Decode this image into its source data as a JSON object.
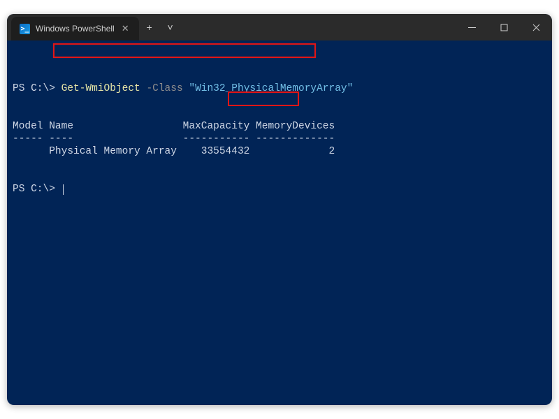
{
  "titlebar": {
    "tab_title": "Windows PowerShell",
    "newtab": "+",
    "dropdown": "˅"
  },
  "terminal": {
    "prompt1": "PS C:\\> ",
    "cmd": "Get-WmiObject",
    "sp1": " ",
    "param": "-Class",
    "sp2": " ",
    "arg": "\"Win32_PhysicalMemoryArray\"",
    "blank1": "",
    "blank2": "",
    "header": "Model Name                  MaxCapacity MemoryDevices",
    "divider": "----- ----                  ----------- -------------",
    "row": "      Physical Memory Array    33554432             2",
    "blank3": "",
    "blank4": "",
    "prompt2": "PS C:\\> "
  },
  "chart_data": {
    "type": "table",
    "title": "Get-WmiObject -Class \"Win32_PhysicalMemoryArray\"",
    "columns": [
      "Model",
      "Name",
      "MaxCapacity",
      "MemoryDevices"
    ],
    "rows": [
      {
        "Model": "",
        "Name": "Physical Memory Array",
        "MaxCapacity": 33554432,
        "MemoryDevices": 2
      }
    ]
  }
}
